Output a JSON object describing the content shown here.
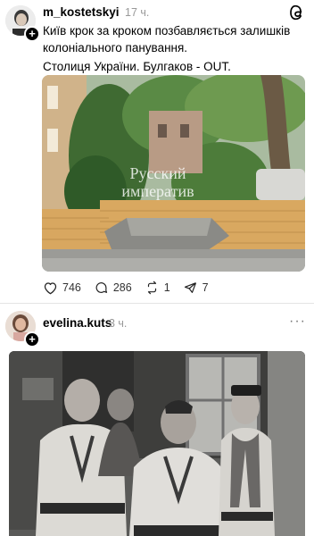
{
  "post1": {
    "username": "m_kostetskyi",
    "time": "17 ч.",
    "line1": "Київ крок за кроком позбавляється залишків",
    "line2": "колоніального панування.",
    "line3": "Столиця України. Булгаков - OUT.",
    "image_text_line1": "Русский",
    "image_text_line2": "императив",
    "likes": "746",
    "comments": "286",
    "reposts": "1",
    "shares": "7"
  },
  "post2": {
    "username": "evelina.kuts",
    "time": "3 ч.",
    "more": "···"
  },
  "colors": {
    "text": "#000000",
    "secondary": "#999999",
    "divider": "#e4e4e4"
  }
}
